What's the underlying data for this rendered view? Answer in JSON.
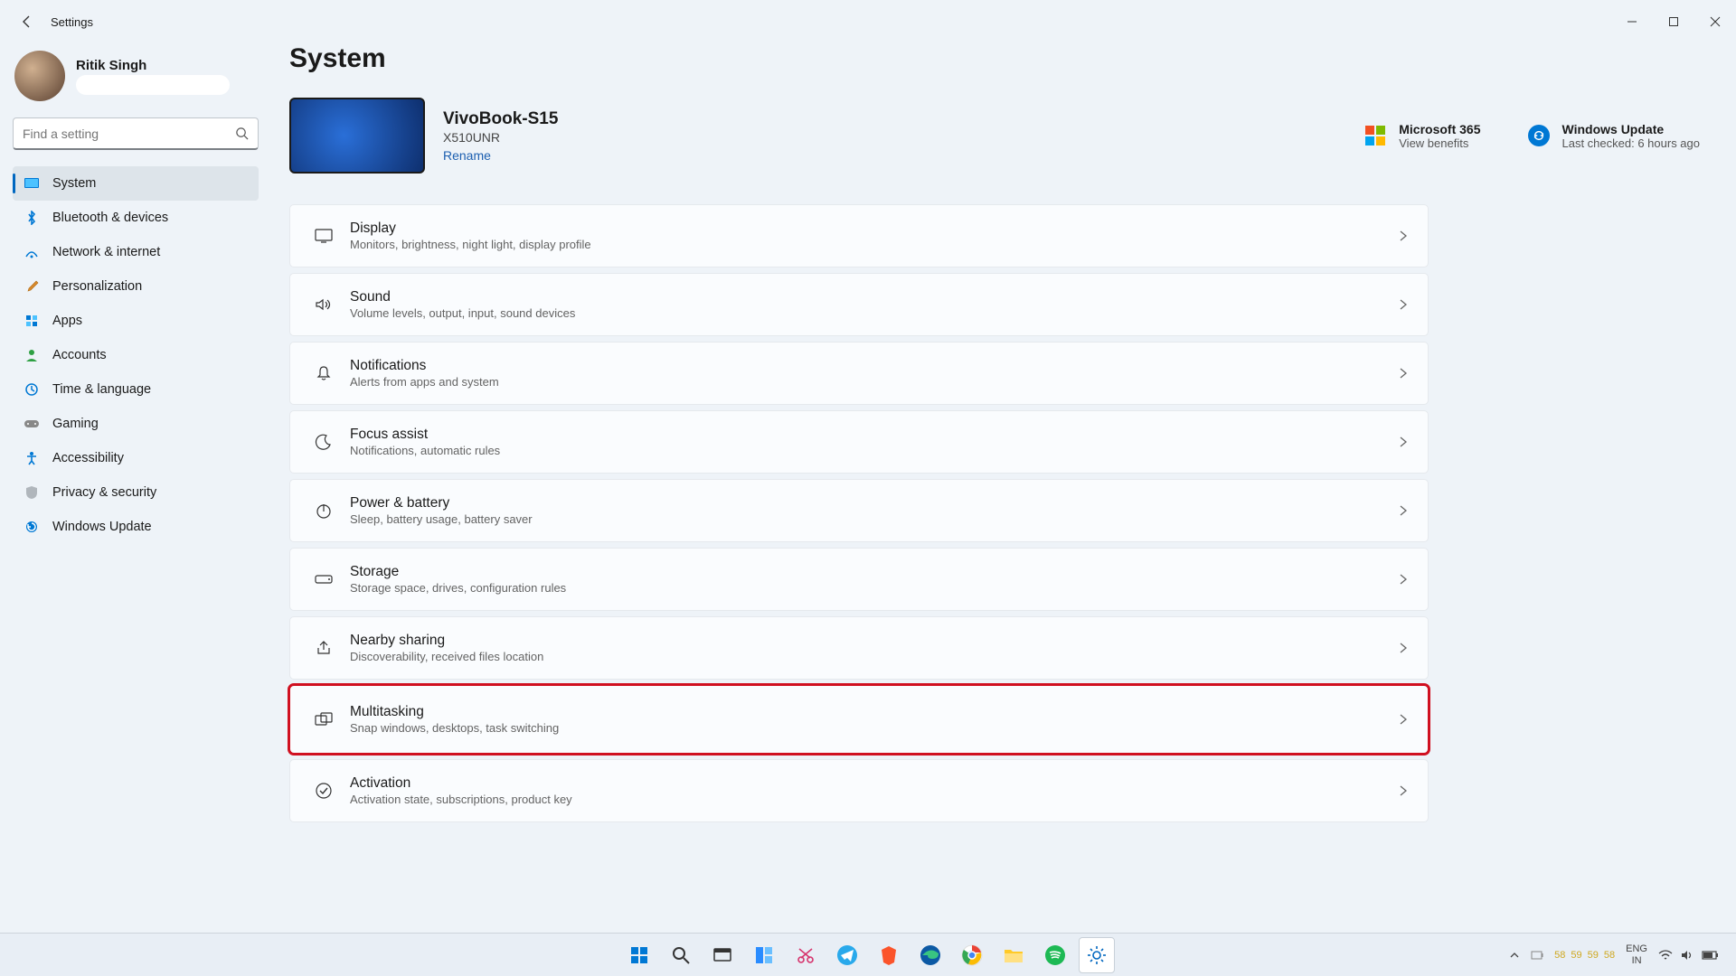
{
  "titlebar": {
    "title": "Settings"
  },
  "profile": {
    "name": "Ritik Singh"
  },
  "search": {
    "placeholder": "Find a setting"
  },
  "sidebar": {
    "items": [
      {
        "label": "System",
        "icon": "💻",
        "active": true
      },
      {
        "label": "Bluetooth & devices",
        "icon": "bt"
      },
      {
        "label": "Network & internet",
        "icon": "🌐"
      },
      {
        "label": "Personalization",
        "icon": "🖌️"
      },
      {
        "label": "Apps",
        "icon": "📦"
      },
      {
        "label": "Accounts",
        "icon": "👤"
      },
      {
        "label": "Time & language",
        "icon": "🕑"
      },
      {
        "label": "Gaming",
        "icon": "🎮"
      },
      {
        "label": "Accessibility",
        "icon": "♿"
      },
      {
        "label": "Privacy & security",
        "icon": "🛡️"
      },
      {
        "label": "Windows Update",
        "icon": "🔄"
      }
    ]
  },
  "page": {
    "title": "System"
  },
  "device": {
    "name": "VivoBook-S15",
    "model": "X510UNR",
    "rename": "Rename"
  },
  "header_cards": {
    "ms365": {
      "title": "Microsoft 365",
      "sub": "View benefits"
    },
    "update": {
      "title": "Windows Update",
      "sub": "Last checked: 6 hours ago"
    }
  },
  "settings": [
    {
      "title": "Display",
      "sub": "Monitors, brightness, night light, display profile",
      "icon": "display"
    },
    {
      "title": "Sound",
      "sub": "Volume levels, output, input, sound devices",
      "icon": "sound"
    },
    {
      "title": "Notifications",
      "sub": "Alerts from apps and system",
      "icon": "bell"
    },
    {
      "title": "Focus assist",
      "sub": "Notifications, automatic rules",
      "icon": "moon"
    },
    {
      "title": "Power & battery",
      "sub": "Sleep, battery usage, battery saver",
      "icon": "power"
    },
    {
      "title": "Storage",
      "sub": "Storage space, drives, configuration rules",
      "icon": "drive"
    },
    {
      "title": "Nearby sharing",
      "sub": "Discoverability, received files location",
      "icon": "share"
    },
    {
      "title": "Multitasking",
      "sub": "Snap windows, desktops, task switching",
      "icon": "multi",
      "highlighted": true
    },
    {
      "title": "Activation",
      "sub": "Activation state, subscriptions, product key",
      "icon": "check"
    }
  ],
  "taskbar": {
    "temps": [
      "58",
      "59",
      "59",
      "58"
    ],
    "lang1": "ENG",
    "lang2": "IN"
  }
}
